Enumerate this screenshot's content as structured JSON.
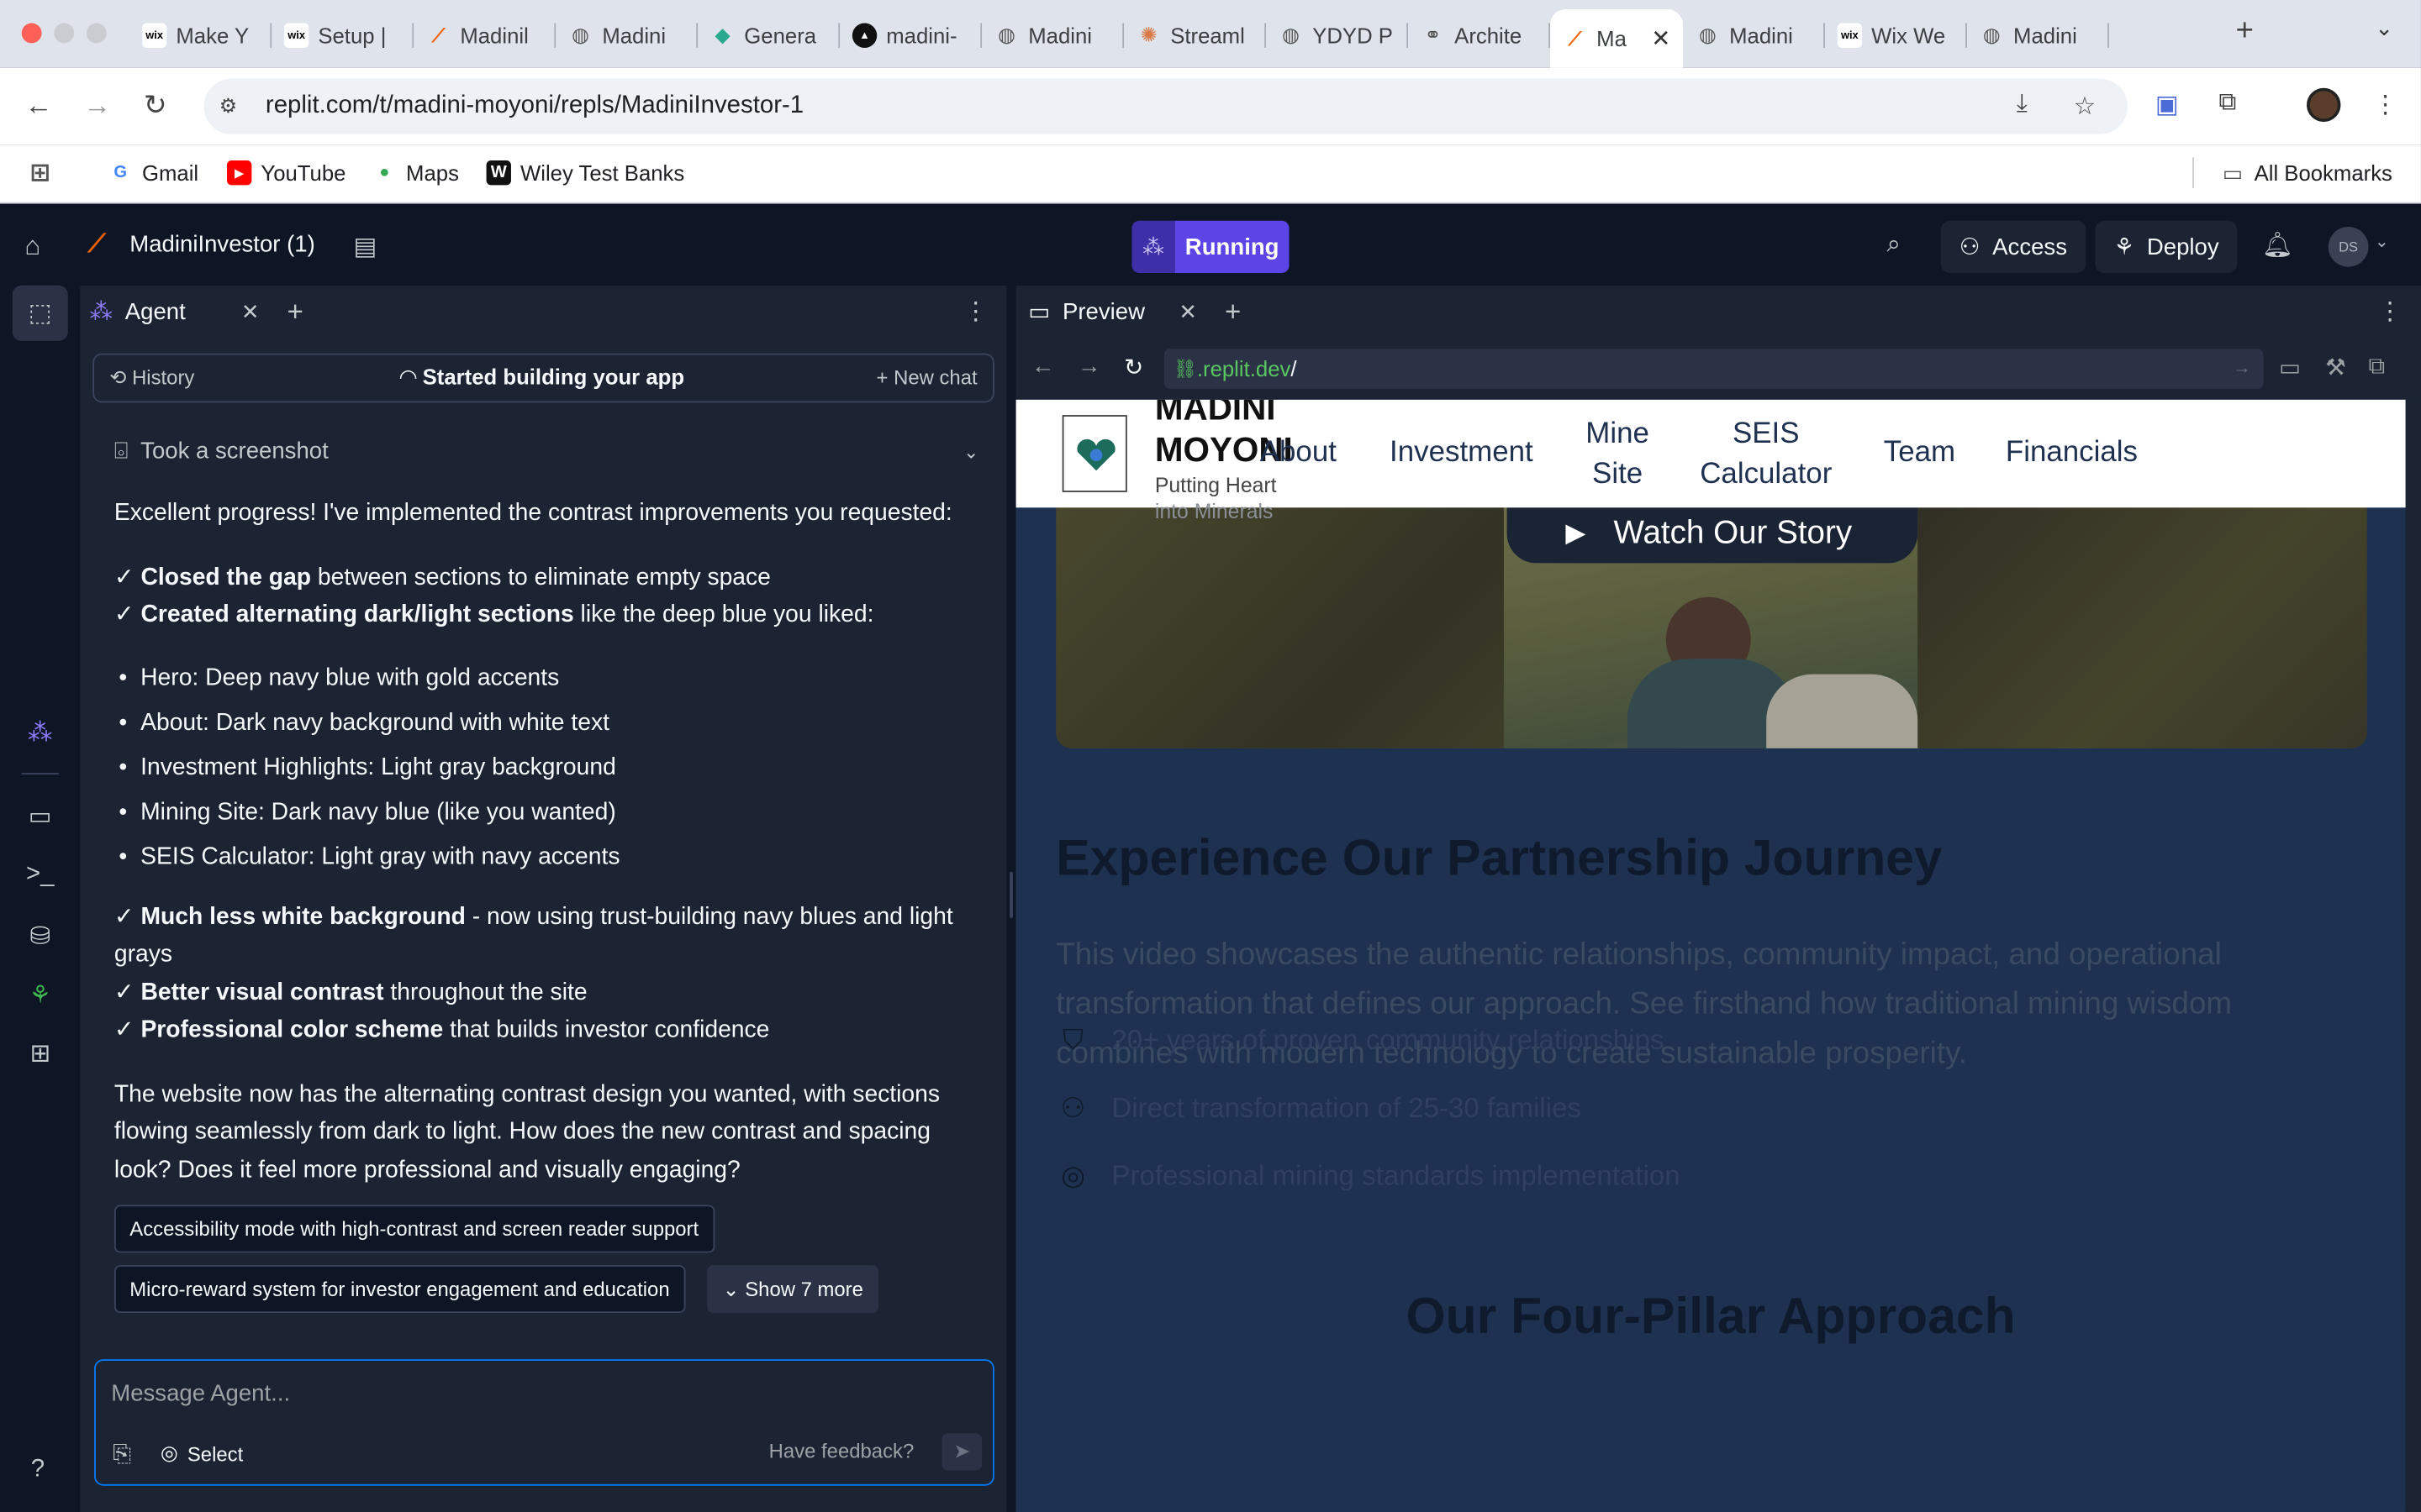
{
  "browser": {
    "tabs": [
      {
        "label": "Make Y",
        "favicon": "WIX",
        "favcolor": "#ffffff"
      },
      {
        "label": "Setup |",
        "favicon": "WIX",
        "favcolor": "#ffffff"
      },
      {
        "label": "Madinil",
        "favicon": "R",
        "favcolor": "#f26207"
      },
      {
        "label": "Madini",
        "favicon": "globe",
        "favcolor": "#555"
      },
      {
        "label": "Genera",
        "favicon": "diamond",
        "favcolor": "#2aa890"
      },
      {
        "label": "madini-",
        "favicon": "A",
        "favcolor": "#111"
      },
      {
        "label": "Madini",
        "favicon": "globe",
        "favcolor": "#555"
      },
      {
        "label": "Streaml",
        "favicon": "sun",
        "favcolor": "#d97745"
      },
      {
        "label": "YDYD P",
        "favicon": "globe",
        "favcolor": "#555"
      },
      {
        "label": "Archite",
        "favicon": "knot",
        "favcolor": "#555"
      },
      {
        "label": "Ma",
        "favicon": "R",
        "favcolor": "#f26207",
        "active": true
      },
      {
        "label": "Madini",
        "favicon": "globe",
        "favcolor": "#555"
      },
      {
        "label": "Wix We",
        "favicon": "WIX",
        "favcolor": "#ffffff"
      },
      {
        "label": "Madini",
        "favicon": "globe",
        "favcolor": "#555"
      }
    ],
    "url": "replit.com/t/madini-moyoni/repls/MadiniInvestor-1",
    "bookmarks": {
      "gmail": "Gmail",
      "youtube": "YouTube",
      "maps": "Maps",
      "wiley": "Wiley Test Banks",
      "all": "All Bookmarks"
    }
  },
  "replit": {
    "project": "MadiniInvestor (1)",
    "run_status": "Running",
    "access": "Access",
    "deploy": "Deploy",
    "user_initials": "DS"
  },
  "agent": {
    "tab_label": "Agent",
    "history": "History",
    "status": "Started building your app",
    "new_chat": "New chat",
    "screenshot": "Took a screenshot",
    "intro": "Excellent progress! I've implemented the contrast improvements you requested:",
    "check1_bold": "Closed the gap",
    "check1_rest": " between sections to eliminate empty space",
    "check2_bold": "Created alternating dark/light sections",
    "check2_rest": " like the deep blue you liked:",
    "bullets": [
      "Hero: Deep navy blue with gold accents",
      "About: Dark navy background with white text",
      "Investment Highlights: Light gray background",
      "Mining Site: Dark navy blue (like you wanted)",
      "SEIS Calculator: Light gray with navy accents"
    ],
    "check3_bold": "Much less white background",
    "check3_rest": " - now using trust-building navy blues and light grays",
    "check4_bold": "Better visual contrast",
    "check4_rest": " throughout the site",
    "check5_bold": "Professional color scheme",
    "check5_rest": " that builds investor confidence",
    "closing": "The website now has the alternating contrast design you wanted, with sections flowing seamlessly from dark to light. How does the new contrast and spacing look? Does it feel more professional and visually engaging?",
    "suggestion1": "Accessibility mode with high-contrast and screen reader support",
    "suggestion2": "Micro-reward system for investor engagement and education",
    "show_more": "Show 7 more",
    "input_placeholder": "Message Agent...",
    "select": "Select",
    "feedback": "Have feedback?"
  },
  "preview": {
    "tab_label": "Preview",
    "url_domain": ".replit.dev",
    "url_path": "/",
    "site": {
      "brand_line1": "MADINI",
      "brand_line2": "MOYONI",
      "tagline1": "Putting Heart",
      "tagline2": "into Minerals",
      "nav": {
        "about": "About",
        "investment": "Investment",
        "mine_line1": "Mine",
        "mine_line2": "Site",
        "seis_line1": "SEIS",
        "seis_line2": "Calculator",
        "team": "Team",
        "financials": "Financials"
      },
      "watch": "Watch Our Story",
      "heading": "Experience Our Partnership Journey",
      "description": "This video showcases the authentic relationships, community impact, and operational transformation that defines our approach. See firsthand how traditional mining wisdom combines with modern technology to create sustainable prosperity.",
      "features": [
        {
          "icon": "shield-icon",
          "text": "20+ years of proven community relationships"
        },
        {
          "icon": "users-icon",
          "text": "Direct transformation of 25-30 families"
        },
        {
          "icon": "target-icon",
          "text": "Professional mining standards implementation"
        }
      ],
      "pillars_heading": "Our Four-Pillar Approach"
    }
  },
  "colors": {
    "ide_bg": "#0e1525",
    "panel_bg": "#1c2333",
    "running": "#5b45e6",
    "site_section_bg": "#1f3150"
  }
}
